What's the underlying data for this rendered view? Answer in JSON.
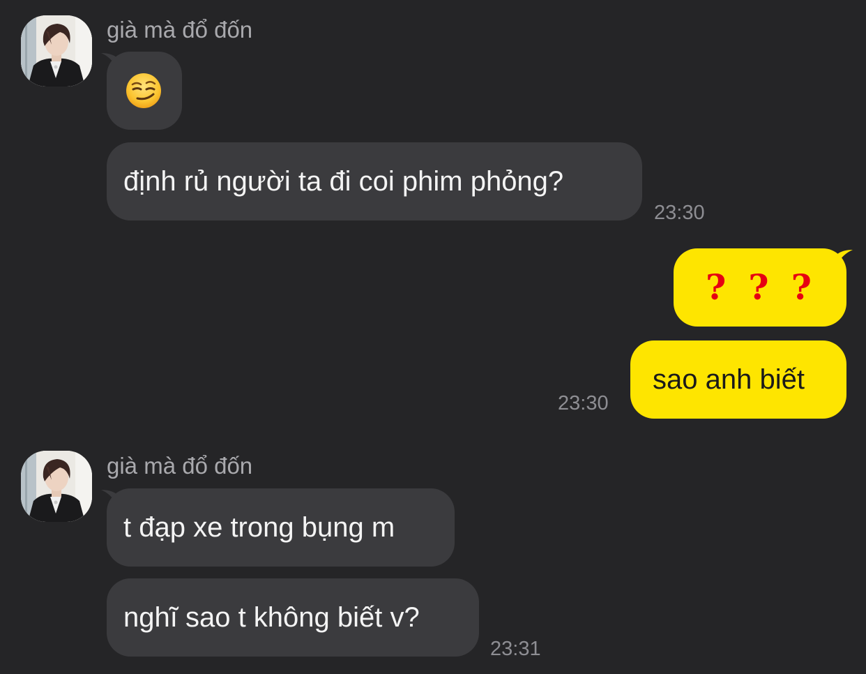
{
  "conversation": {
    "colors": {
      "background": "#252527",
      "incoming_bubble": "#3b3b3e",
      "outgoing_bubble": "#fee500",
      "question_mark": "#e60012"
    },
    "groups": [
      {
        "sender": "già mà đổ đốn",
        "messages": [
          {
            "type": "emoji",
            "icon": "smirking-face-emoji"
          },
          {
            "type": "text",
            "text": "định rủ người ta đi coi phim phỏng?"
          }
        ],
        "time": "23:30"
      },
      {
        "sender": "me",
        "messages": [
          {
            "type": "emoji",
            "text": "？？？",
            "glyphs": [
              "?",
              "?",
              "?"
            ]
          },
          {
            "type": "text",
            "text": "sao anh biết"
          }
        ],
        "time": "23:30"
      },
      {
        "sender": "già mà đổ đốn",
        "messages": [
          {
            "type": "text",
            "text": "t đạp xe trong bụng m"
          },
          {
            "type": "text",
            "text": "nghĩ sao t không biết v?"
          }
        ],
        "time": "23:31"
      }
    ]
  }
}
